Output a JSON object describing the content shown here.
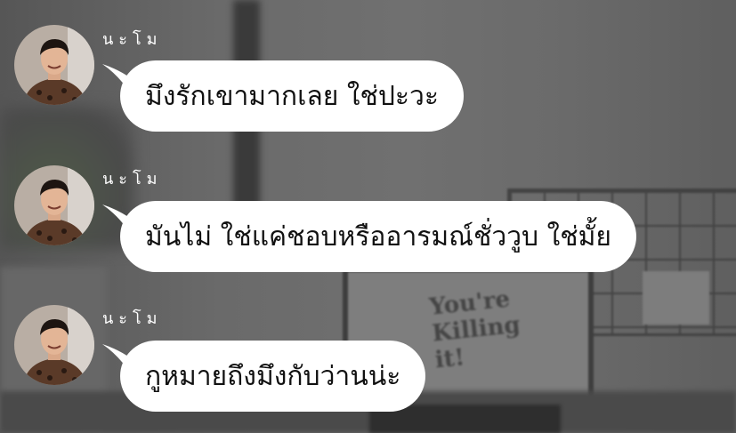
{
  "messages": [
    {
      "sender": "นะโม",
      "text": "มึงรักเขามากเลย ใช่ปะวะ"
    },
    {
      "sender": "นะโม",
      "text": "มันไม่ ใช่แค่ชอบหรืออารมณ์ชั่ววูบ ใช่มั้ย"
    },
    {
      "sender": "นะโม",
      "text": "กูหมายถึงมึงกับว่านน่ะ"
    }
  ],
  "background": {
    "poster_text": "You're Killing it!"
  },
  "colors": {
    "bubble": "#ffffff",
    "text": "#111111",
    "sender_name": "#ffffff",
    "overlay": "#5b5b5b"
  }
}
